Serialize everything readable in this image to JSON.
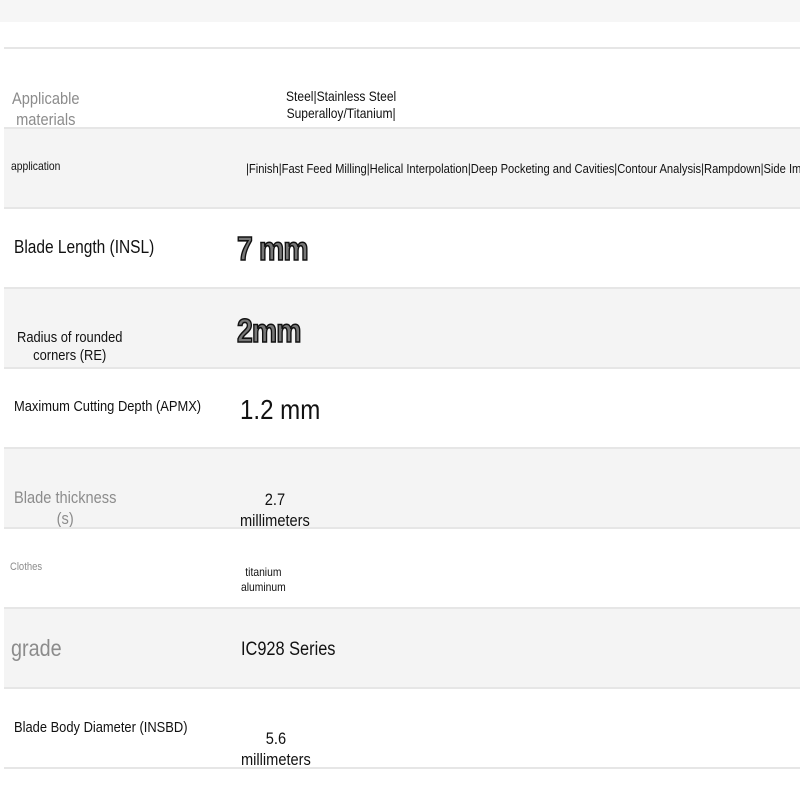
{
  "rows": [
    {
      "label": "Applicable\nmaterials",
      "value": "Steel|Stainless Steel\nSuperalloy/Titanium|"
    },
    {
      "label": "application",
      "value": "|Finish|Fast Feed Milling|Helical Interpolation|Deep Pocketing and Cavities|Contour Analysis|Rampdown|Side Immer"
    },
    {
      "label": "Blade Length (INSL)",
      "value": "7 mm"
    },
    {
      "label": "Radius of rounded\ncorners (RE)",
      "value": "2mm"
    },
    {
      "label": "Maximum Cutting Depth (APMX)",
      "value": "1.2 mm"
    },
    {
      "label": "Blade thickness\n(s)",
      "value": "2.7\nmillimeters"
    },
    {
      "label": "Clothes",
      "value": "titanium\naluminum"
    },
    {
      "label": "grade",
      "value": "IC928 Series"
    },
    {
      "label": "Blade Body Diameter (INSBD)",
      "value": "5.6\nmillimeters"
    }
  ]
}
